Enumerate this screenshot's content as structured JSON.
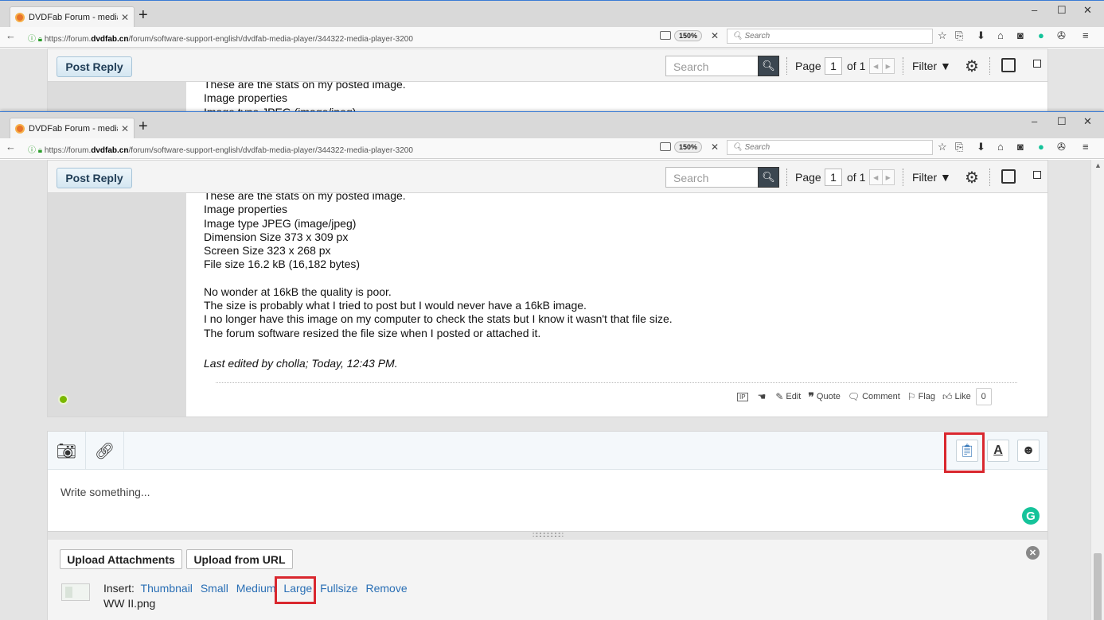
{
  "browser": {
    "tab_title": "DVDFab Forum - media play",
    "tab_close": "✕",
    "new_tab": "+",
    "url_prefix": "https://forum.",
    "url_host": "dvdfab.cn",
    "url_path": "/forum/software-support-english/dvdfab-media-player/344322-media-player-3200",
    "zoom": "150%",
    "search_placeholder": "Search",
    "window_controls": [
      "–",
      "☐",
      "✕"
    ],
    "toolbar_icons": [
      "star-icon",
      "bookmarks-list-icon",
      "download-icon",
      "home-icon",
      "pocket-icon",
      "grammarly-icon",
      "extension-icon",
      "menu-icon"
    ]
  },
  "topbar": {
    "post_reply": "Post Reply",
    "search_placeholder": "Search",
    "page_label": "Page",
    "page_number": "1",
    "page_of": "of 1",
    "filter_label": "Filter ▼"
  },
  "post": {
    "cut_line": "These are the stats on my posted image.",
    "lines": [
      "Image properties",
      "Image type JPEG (image/jpeg)",
      "Dimension Size 373 x 309 px",
      "Screen Size 323 x 268 px",
      "File size 16.2 kB (16,182 bytes)"
    ],
    "para2": [
      "No wonder at 16kB the quality is poor.",
      "The size is probably what I tried to post but I would never have a 16kB image.",
      "I no longer have this image on my computer to check the stats but I know it wasn't that file size.",
      "The forum software resized the file size when I posted or attached it."
    ],
    "edited": "Last edited by cholla; Today, 12:43 PM.",
    "actions": {
      "ip": "IP",
      "edit": "Edit",
      "quote": "Quote",
      "comment": "Comment",
      "flag": "Flag",
      "like": "Like",
      "like_count": "0"
    }
  },
  "editor": {
    "placeholder": "Write something...",
    "grammarly": "G",
    "upload_attachments": "Upload Attachments",
    "upload_from_url": "Upload from URL",
    "close": "✕",
    "insert_label": "Insert:",
    "insert_options": [
      "Thumbnail",
      "Small",
      "Medium",
      "Large",
      "Fullsize",
      "Remove"
    ],
    "filename": "WW II.png"
  },
  "colors": {
    "highlight": "#d9272e",
    "link": "#2a6fb5",
    "online": "#7ab800"
  }
}
